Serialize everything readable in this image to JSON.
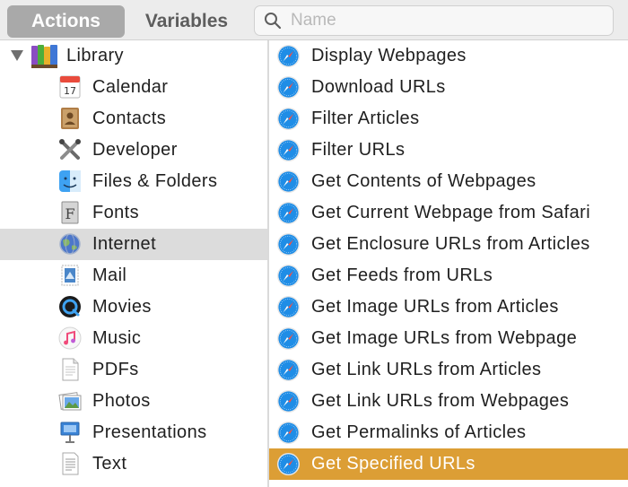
{
  "toolbar": {
    "actions_tab": "Actions",
    "variables_tab": "Variables",
    "search_placeholder": "Name",
    "search_value": ""
  },
  "library": {
    "root_label": "Library",
    "items": [
      {
        "label": "Calendar",
        "icon": "calendar-icon"
      },
      {
        "label": "Contacts",
        "icon": "contacts-icon"
      },
      {
        "label": "Developer",
        "icon": "developer-tools-icon"
      },
      {
        "label": "Files & Folders",
        "icon": "finder-icon"
      },
      {
        "label": "Fonts",
        "icon": "font-book-icon"
      },
      {
        "label": "Internet",
        "icon": "globe-icon",
        "selected": true
      },
      {
        "label": "Mail",
        "icon": "mail-stamp-icon"
      },
      {
        "label": "Movies",
        "icon": "quicktime-icon"
      },
      {
        "label": "Music",
        "icon": "music-note-icon"
      },
      {
        "label": "PDFs",
        "icon": "pdf-document-icon"
      },
      {
        "label": "Photos",
        "icon": "photos-icon"
      },
      {
        "label": "Presentations",
        "icon": "keynote-icon"
      },
      {
        "label": "Text",
        "icon": "text-document-icon"
      }
    ]
  },
  "actions": {
    "items": [
      {
        "label": "Display Webpages"
      },
      {
        "label": "Download URLs"
      },
      {
        "label": "Filter Articles"
      },
      {
        "label": "Filter URLs"
      },
      {
        "label": "Get Contents of Webpages"
      },
      {
        "label": "Get Current Webpage from Safari"
      },
      {
        "label": "Get Enclosure URLs from Articles"
      },
      {
        "label": "Get Feeds from URLs"
      },
      {
        "label": "Get Image URLs from Articles"
      },
      {
        "label": "Get Image URLs from Webpage"
      },
      {
        "label": "Get Link URLs from Articles"
      },
      {
        "label": "Get Link URLs from Webpages"
      },
      {
        "label": "Get Permalinks of Articles"
      },
      {
        "label": "Get Specified URLs",
        "selected": true
      }
    ],
    "icon": "safari-compass-icon"
  },
  "colors": {
    "selection_accent": "#dc9e35",
    "sidebar_selection": "#dcdcdc",
    "safari_blue": "#1f8de6"
  }
}
